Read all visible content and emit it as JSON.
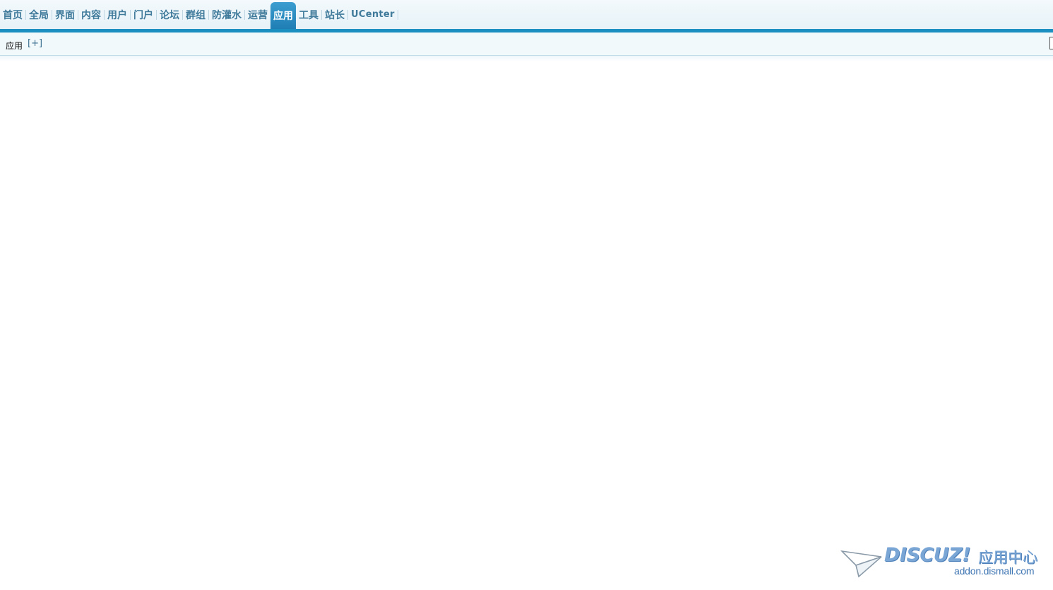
{
  "nav": {
    "items": [
      {
        "label": "首页",
        "active": false
      },
      {
        "label": "全局",
        "active": false
      },
      {
        "label": "界面",
        "active": false
      },
      {
        "label": "内容",
        "active": false
      },
      {
        "label": "用户",
        "active": false
      },
      {
        "label": "门户",
        "active": false
      },
      {
        "label": "论坛",
        "active": false
      },
      {
        "label": "群组",
        "active": false
      },
      {
        "label": "防灌水",
        "active": false
      },
      {
        "label": "运营",
        "active": false
      },
      {
        "label": "应用",
        "active": true
      },
      {
        "label": "工具",
        "active": false
      },
      {
        "label": "站长",
        "active": false
      },
      {
        "label": "UCenter",
        "active": false
      }
    ]
  },
  "breadcrumb": {
    "current": "应用",
    "add_label": "[+]"
  },
  "logo": {
    "brand": "DISCUZ!",
    "subtitle": "应用中心",
    "url": "addon.dismall.com",
    "icon": "paper-plane-icon"
  },
  "colors": {
    "accent": "#1a8fc0",
    "nav_text": "#3f7a9b",
    "active_tab": "#2b8cc4",
    "logo": "#7aa6d6"
  }
}
